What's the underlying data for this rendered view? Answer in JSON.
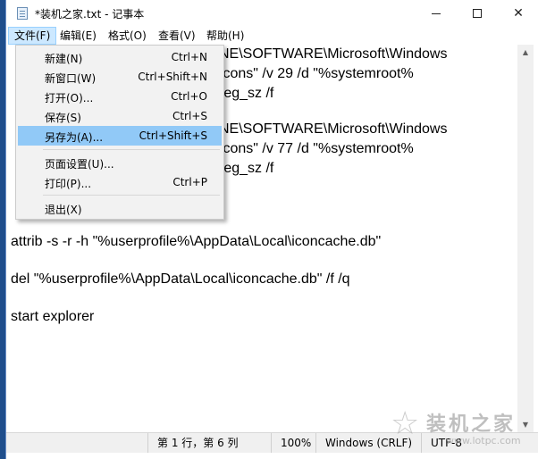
{
  "window": {
    "title": "*装机之家.txt - 记事本",
    "min_label": "",
    "close_label": "✕"
  },
  "menubar": [
    "文件(F)",
    "编辑(E)",
    "格式(O)",
    "查看(V)",
    "帮助(H)"
  ],
  "file_menu": [
    {
      "label": "新建(N)",
      "shortcut": "Ctrl+N"
    },
    {
      "label": "新窗口(W)",
      "shortcut": "Ctrl+Shift+N"
    },
    {
      "label": "打开(O)...",
      "shortcut": "Ctrl+O"
    },
    {
      "label": "保存(S)",
      "shortcut": "Ctrl+S"
    },
    {
      "label": "另存为(A)...",
      "shortcut": "Ctrl+Shift+S"
    },
    {
      "label": "页面设置(U)...",
      "shortcut": ""
    },
    {
      "label": "打印(P)...",
      "shortcut": "Ctrl+P"
    },
    {
      "label": "退出(X)",
      "shortcut": ""
    }
  ],
  "editor": {
    "lines": [
      "NE\\SOFTWARE\\Microsoft\\Windows",
      "Icons\" /v 29 /d \"%systemroot%",
      "reg_sz /f",
      "NE\\SOFTWARE\\Microsoft\\Windows",
      "Icons\" /v 77 /d \"%systemroot%",
      "reg_sz /f",
      "attrib -s -r -h \"%userprofile%\\AppData\\Local\\iconcache.db\"",
      "del \"%userprofile%\\AppData\\Local\\iconcache.db\" /f /q",
      "start explorer"
    ]
  },
  "status": {
    "position": "第 1 行，第 6 列",
    "zoom": "100%",
    "line_ending": "Windows (CRLF)",
    "encoding": "UTF-8"
  },
  "watermark": {
    "text": "装机之家",
    "url": "www.lotpc.com"
  },
  "colors": {
    "menu_highlight": "#91c9f7",
    "menubar_active": "#cce8ff"
  }
}
